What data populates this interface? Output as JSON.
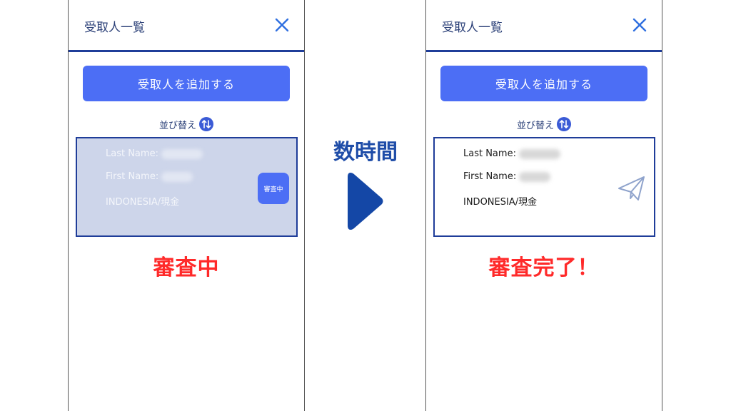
{
  "left": {
    "header": {
      "title": "受取人一覧"
    },
    "add_button": "受取人を追加する",
    "sort_label": "並び替え",
    "card": {
      "last_name_label": "Last Name:",
      "first_name_label": "First Name:",
      "location": "INDONESIA/現金",
      "badge": "審査中"
    },
    "caption": "審査中"
  },
  "middle": {
    "label": "数時間"
  },
  "right": {
    "header": {
      "title": "受取人一覧"
    },
    "add_button": "受取人を追加する",
    "sort_label": "並び替え",
    "card": {
      "last_name_label": "Last Name:",
      "first_name_label": "First Name:",
      "location": "INDONESIA/現金"
    },
    "caption": "審査完了！"
  },
  "icons": {
    "close": "close-icon",
    "sort": "sort-arrows-icon",
    "send": "paper-plane-icon",
    "next": "play-arrow-icon"
  },
  "colors": {
    "header_rule": "#1f3d99",
    "button": "#4c6ef5",
    "pending_card": "#cdd5ea",
    "caption": "#ff2a2a",
    "middle_text": "#1f4da8"
  }
}
